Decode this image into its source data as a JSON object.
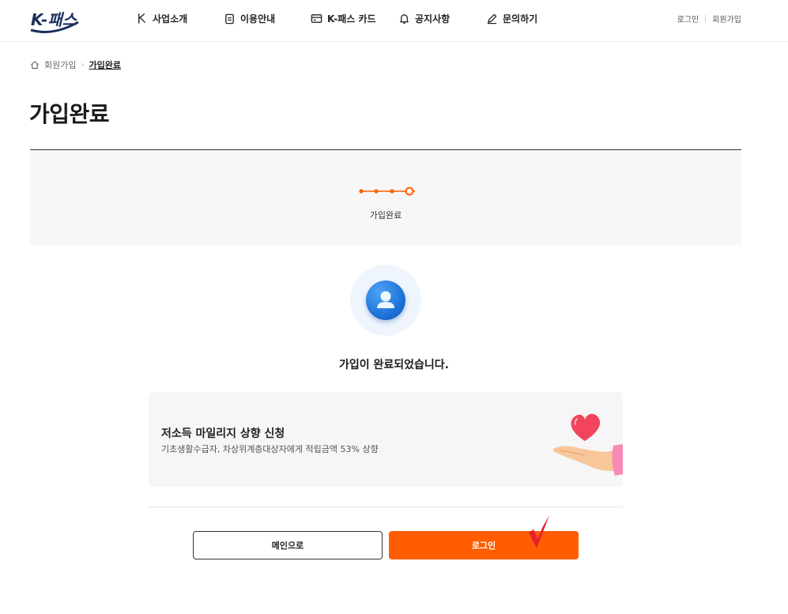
{
  "header": {
    "logo_text": "K-패스",
    "nav": [
      {
        "label": "사업소개",
        "icon": "k-leaf-icon"
      },
      {
        "label": "이용안내",
        "icon": "clipboard-icon"
      },
      {
        "label": "K-패스 카드",
        "icon": "card-icon"
      },
      {
        "label": "공지사항",
        "icon": "bell-icon"
      },
      {
        "label": "문의하기",
        "icon": "pencil-icon"
      }
    ],
    "login": "로그인",
    "signup": "회원가입"
  },
  "breadcrumb": {
    "parent": "회원가입",
    "current": "가입완료"
  },
  "page_title": "가입완료",
  "steps": {
    "count": 4,
    "current_index": 4,
    "label": "가입완료"
  },
  "main": {
    "message": "가입이 완료되었습니다."
  },
  "promo": {
    "title": "저소득 마일리지 상향 신청",
    "desc": "기초생활수급자, 차상위계층대상자에게 적립금액 53% 상향"
  },
  "buttons": {
    "main": "메인으로",
    "login": "로그인"
  },
  "colors": {
    "accent": "#ff5d00",
    "brand": "#1b2f5c",
    "avatar_blue": "#1f73d8"
  }
}
